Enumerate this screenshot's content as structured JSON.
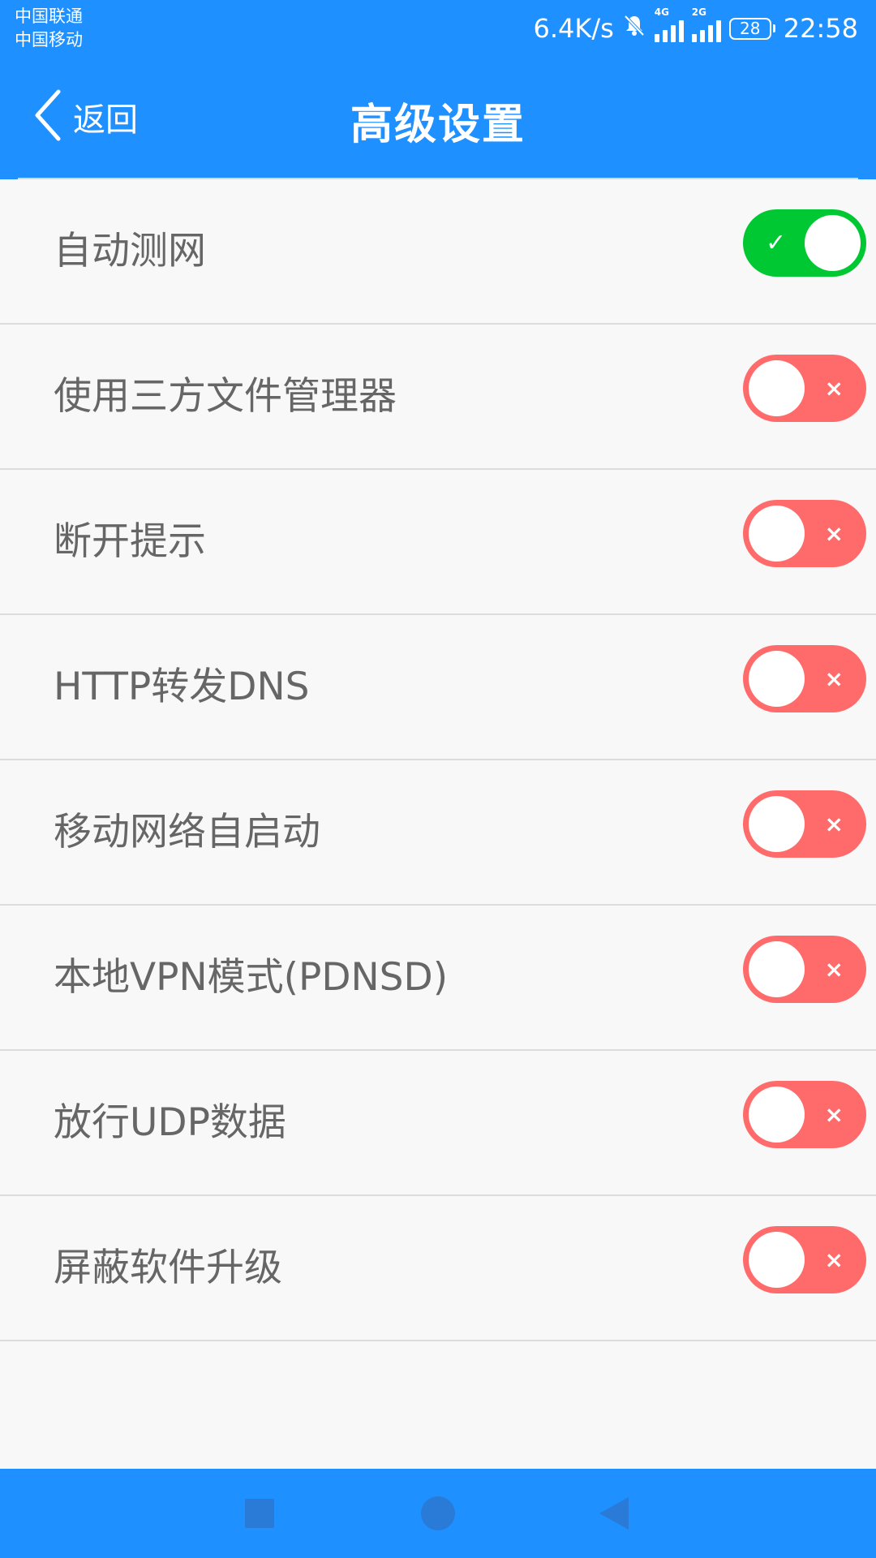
{
  "status_bar": {
    "carrier_1": "中国联通",
    "carrier_2": "中国移动",
    "net_speed": "6.4K/s",
    "signal_1_type": "4G",
    "signal_2_type": "2G",
    "battery": "28",
    "time": "22:58",
    "icons": [
      "mute-bell-icon",
      "signal-icon",
      "signal-icon",
      "battery-icon"
    ]
  },
  "header": {
    "back_label": "返回",
    "title": "高级设置",
    "icon": "chevron-left-icon"
  },
  "settings": [
    {
      "label": "自动测网",
      "enabled": true
    },
    {
      "label": "使用三方文件管理器",
      "enabled": false
    },
    {
      "label": "断开提示",
      "enabled": false
    },
    {
      "label": "HTTP转发DNS",
      "enabled": false
    },
    {
      "label": "移动网络自启动",
      "enabled": false
    },
    {
      "label": "本地VPN模式(PDNSD)",
      "enabled": false
    },
    {
      "label": "放行UDP数据",
      "enabled": false
    },
    {
      "label": "屏蔽软件升级",
      "enabled": false
    }
  ],
  "nav_bar": {
    "icons": [
      "recents-square-icon",
      "home-circle-icon",
      "back-triangle-icon"
    ]
  },
  "colors": {
    "primary": "#1e90ff",
    "switch_on": "#00c832",
    "switch_off": "#ff6b6b",
    "label_text": "#666666",
    "background": "#f8f8f8"
  }
}
